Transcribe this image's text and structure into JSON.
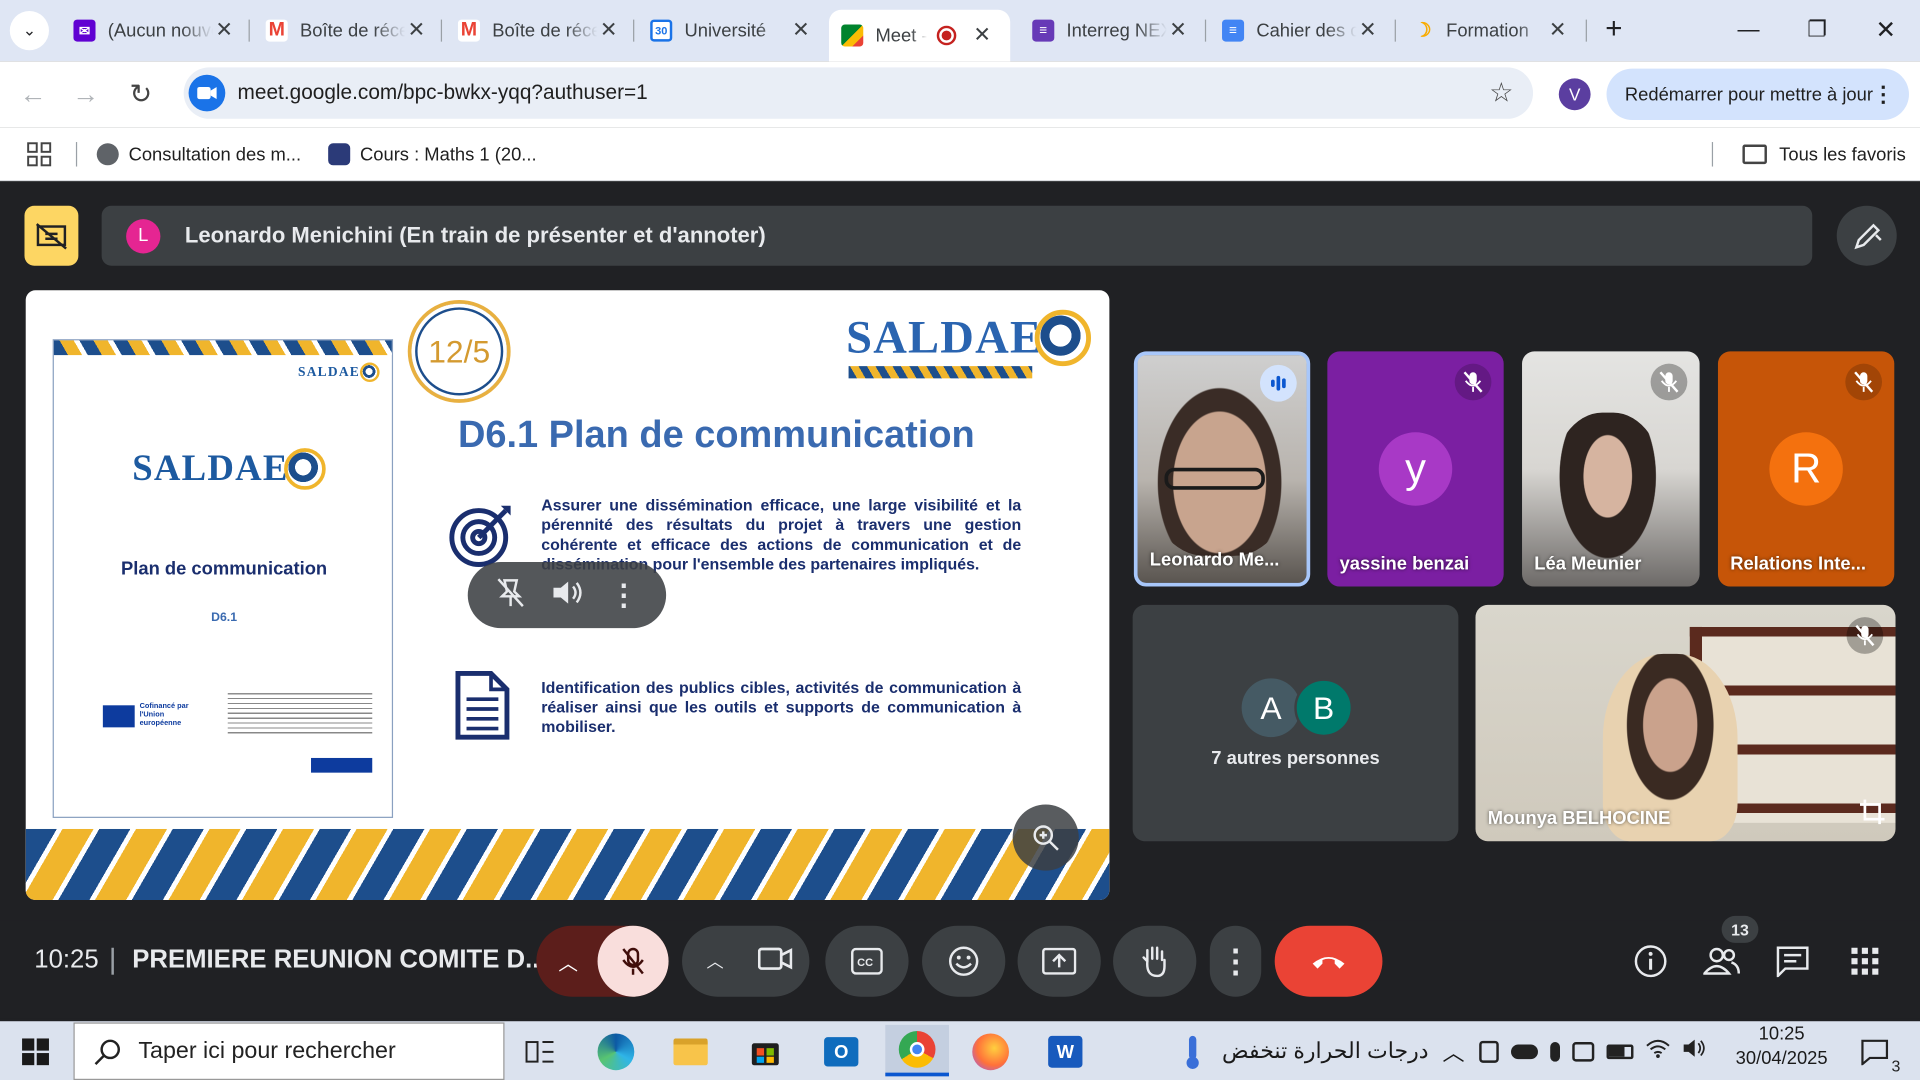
{
  "browser": {
    "tabs": [
      {
        "title": "(Aucun nouvel e-mail)",
        "icon": "yahoo-mail-icon",
        "color": "#6001d2",
        "active": false
      },
      {
        "title": "Boîte de réception",
        "icon": "gmail-icon",
        "color": "#ea4335",
        "active": false
      },
      {
        "title": "Boîte de réception",
        "icon": "gmail-4-icon",
        "color": "#ea4335",
        "active": false
      },
      {
        "title": "Université",
        "icon": "calendar-30-icon",
        "color": "#1a73e8",
        "active": false
      },
      {
        "title": "Meet -",
        "icon": "meet-icon",
        "color": "#00832d",
        "active": true
      },
      {
        "title": "Interreg NEXT",
        "icon": "forms-icon",
        "color": "#673ab7",
        "active": false
      },
      {
        "title": "Cahier des charges",
        "icon": "docs-icon",
        "color": "#4285f4",
        "active": false
      },
      {
        "title": "Formation",
        "icon": "moon-icon",
        "color": "#f9ab00",
        "active": false
      }
    ],
    "url": "meet.google.com/bpc-bwkx-yqq?authuser=1",
    "profile_initial": "V",
    "restart_label": "Redémarrer pour mettre à jour",
    "bookmarks": [
      {
        "label": "Consultation des m...",
        "icon": "globe-icon"
      },
      {
        "label": "Cours : Maths 1 (20...",
        "icon": "shield-crest-icon"
      }
    ],
    "all_bookmarks_label": "Tous les favoris"
  },
  "meet": {
    "presenter_initial": "L",
    "presenter_banner": "Leonardo Menichini (En train de présenter et d'annoter)",
    "slide": {
      "badge": "12/5",
      "logo_text": "SALDAE",
      "title": "D6.1 Plan de communication",
      "doc_title": "Plan de communication",
      "doc_code": "D6.1",
      "doc_eu": "Cofinancé par l'Union européenne",
      "para1": "Assurer une dissémination efficace, une large visibilité et la pérennité des résultats du projet à travers une gestion cohérente et efficace des actions de communication et de dissémination pour l'ensemble des partenaires impliqués.",
      "para2": "Identification des publics cibles, activités de communication à réaliser ainsi que les outils et supports de communication à mobiliser."
    },
    "participants": [
      {
        "name": "Leonardo Me...",
        "status": "speaking",
        "kind": "video"
      },
      {
        "name": "yassine benzai",
        "initial": "y",
        "kind": "avatar",
        "bg": "#7b1fa2",
        "av": "#a839c6"
      },
      {
        "name": "Léa Meunier",
        "status": "muted",
        "kind": "video"
      },
      {
        "name": "Relations Inte...",
        "initial": "R",
        "kind": "avatar",
        "bg": "#c65508",
        "av": "#f4710e"
      }
    ],
    "others": {
      "initials": [
        "A",
        "B"
      ],
      "label": "7 autres personnes"
    },
    "featured": {
      "name": "Mounya BELHOCINE"
    },
    "clock": "10:25",
    "meeting_title": "PREMIERE REUNION COMITE D...",
    "participant_count": "13"
  },
  "taskbar": {
    "search_placeholder": "Taper ici pour rechercher",
    "weather": "درجات الحرارة تنخفض",
    "time": "10:25",
    "date": "30/04/2025",
    "notifications": "3"
  }
}
